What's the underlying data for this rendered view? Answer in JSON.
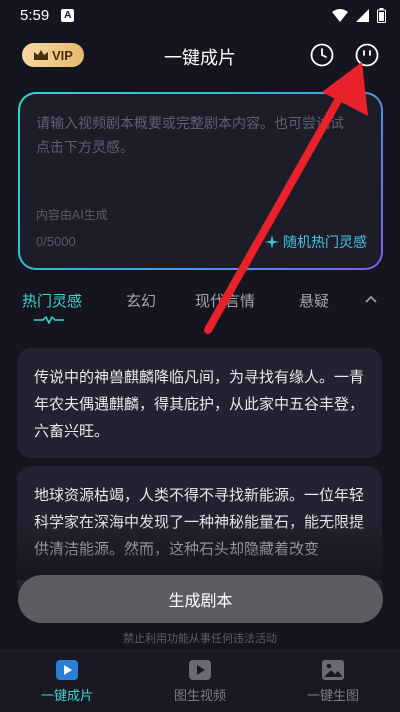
{
  "status": {
    "time": "5:59",
    "notif_letter": "A"
  },
  "header": {
    "vip_label": "VIP",
    "title": "一键成片"
  },
  "input": {
    "placeholder": "请输入视频剧本概要或完整剧本内容。也可尝试试点击下方灵感。",
    "ai_note": "内容由AI生成",
    "count": "0/5000",
    "random_label": "随机热门灵感"
  },
  "tabs": [
    "热门灵感",
    "玄幻",
    "现代言情",
    "悬疑"
  ],
  "stories": [
    "传说中的神兽麒麟降临凡间，为寻找有缘人。一青年农夫偶遇麒麟，得其庇护，从此家中五谷丰登，六畜兴旺。",
    "地球资源枯竭，人类不得不寻找新能源。一位年轻科学家在深海中发现了一种神秘能量石，能无限提供清洁能源。然而，这种石头却隐藏着改变"
  ],
  "generate_label": "生成剧本",
  "disclaimer": "禁止利用功能从事任何违法活动",
  "nav": [
    {
      "label": "一键成片",
      "icon": "play-video-icon"
    },
    {
      "label": "图生视频",
      "icon": "image-video-icon"
    },
    {
      "label": "一键生图",
      "icon": "image-icon"
    }
  ],
  "colors": {
    "accent": "#3dd4d0",
    "arrow": "#e8212b",
    "vip": "#e8b96e"
  }
}
